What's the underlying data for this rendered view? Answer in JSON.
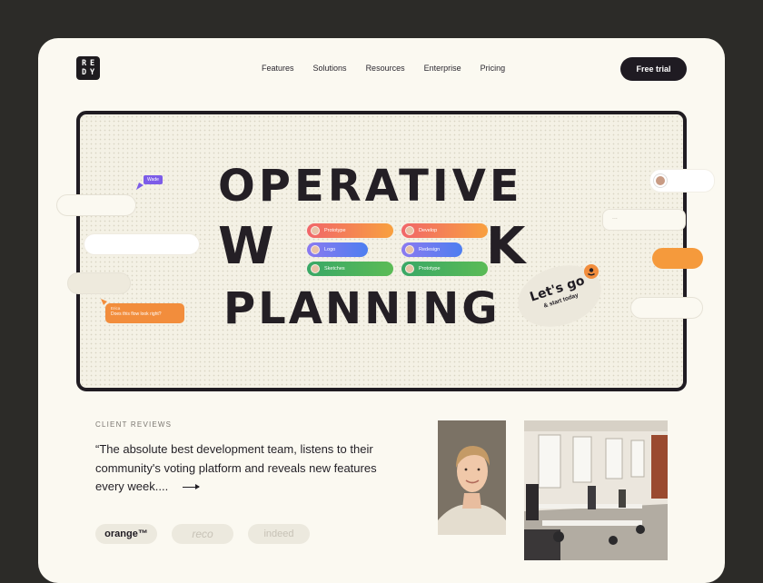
{
  "brand": {
    "logo_letters": [
      "R",
      "E",
      "D",
      "Y"
    ]
  },
  "nav": {
    "items": [
      "Features",
      "Solutions",
      "Resources",
      "Enterprise",
      "Pricing"
    ]
  },
  "header": {
    "cta_label": "Free trial"
  },
  "hero": {
    "line1": "OPERATIVE",
    "line2a": "W",
    "line2b": "K",
    "line3": "PLANNING",
    "tasks": [
      {
        "label": "Prototype",
        "color": "#f07f46"
      },
      {
        "label": "Develop",
        "color": "#f07f46"
      },
      {
        "label": "Logo",
        "color": "#6b6ff0"
      },
      {
        "label": "Redesign",
        "color": "#6b6ff0"
      },
      {
        "label": "Sketches",
        "color": "#3fae62"
      },
      {
        "label": "Prototype",
        "color": "#3fae62"
      }
    ],
    "cursor_tag": "Wade",
    "comment_author": "Erica",
    "comment_text": "Does this flow look right?",
    "lets_go": "Let's go",
    "start_today": "& start today",
    "dots": "..."
  },
  "reviews": {
    "section_label": "CLIENT REVIEWS",
    "quote": "“The absolute best development team, listens to their community's voting platform and reveals new features every week....",
    "clients": [
      "orange™",
      "reco",
      "indeed"
    ]
  },
  "colors": {
    "accent_orange": "#f28d3c",
    "dark": "#1f1b22",
    "background": "#fbf9f1"
  }
}
